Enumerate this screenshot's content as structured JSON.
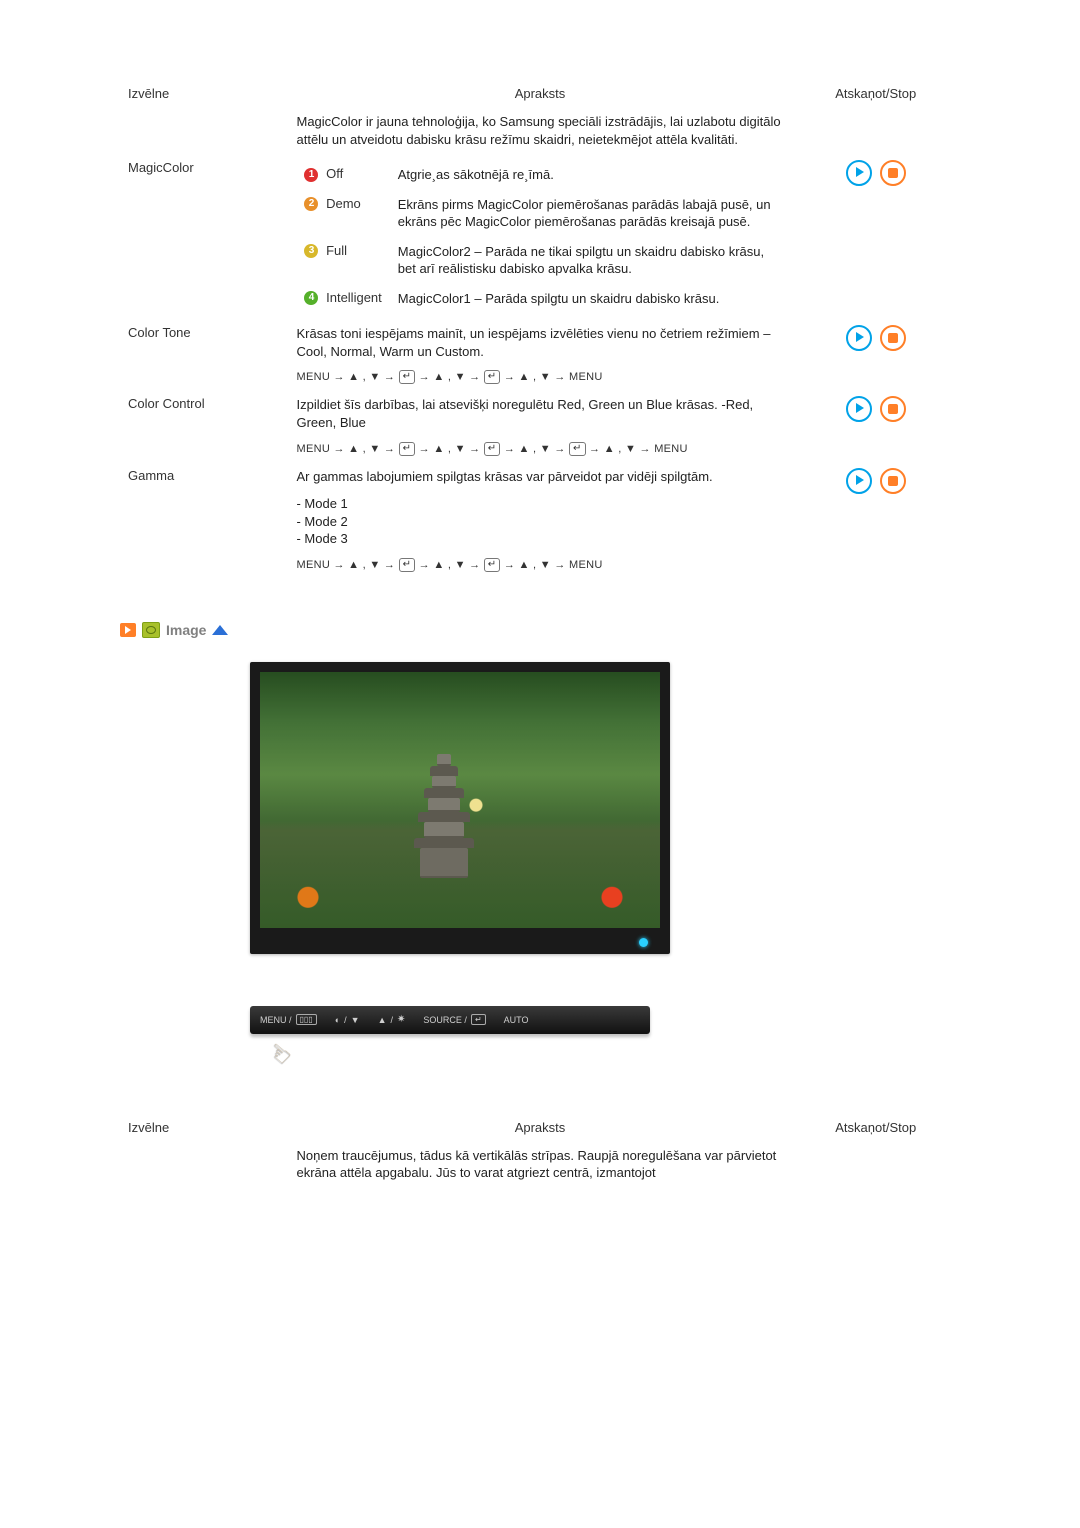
{
  "headers": {
    "menu": "Izvēlne",
    "description": "Apraksts",
    "playstop": "Atskaņot/Stop"
  },
  "magiccolor": {
    "name": "MagicColor",
    "intro": "MagicColor ir jauna tehnoloģija, ko Samsung speciāli izstrādājis, lai uzlabotu digitālo attēlu un atveidotu dabisku krāsu režīmu skaidri, neietekmējot attēla kvalitāti.",
    "opts": [
      {
        "n": "1",
        "label": "Off",
        "desc": "Atgrie¸as sākotnējā re¸īmā."
      },
      {
        "n": "2",
        "label": "Demo",
        "desc": "Ekrāns pirms MagicColor piemērošanas parādās labajā pusē, un ekrāns pēc MagicColor piemērošanas parādās kreisajā pusē."
      },
      {
        "n": "3",
        "label": "Full",
        "desc": "MagicColor2 – Parāda ne tikai spilgtu un skaidru dabisko krāsu, bet arī reālistisku dabisko apvalka krāsu."
      },
      {
        "n": "4",
        "label": "Intelligent",
        "desc": "MagicColor1 – Parāda spilgtu un skaidru dabisko krāsu."
      }
    ]
  },
  "colortone": {
    "name": "Color Tone",
    "desc": "Krāsas toni iespējams mainīt, un iespējams izvēlēties vienu no četriem režīmiem – Cool, Normal, Warm un Custom."
  },
  "colorcontrol": {
    "name": "Color Control",
    "desc": "Izpildiet šīs darbības, lai atsevišķi noregulētu Red, Green un Blue krāsas. -Red, Green, Blue"
  },
  "gamma": {
    "name": "Gamma",
    "desc": "Ar gammas labojumiem spilgtas krāsas var pārveidot par vidēji spilgtām.",
    "modes": "- Mode 1\n- Mode 2\n- Mode 3"
  },
  "nav": {
    "menu": "MENU",
    "arrow": "→",
    "updown": "▲ , ▼",
    "enter": "↵"
  },
  "section": {
    "image": "Image"
  },
  "strip": {
    "menu": "MENU /",
    "source": "SOURCE /",
    "auto": "AUTO"
  },
  "coarse": {
    "desc": "Noņem traucējumus, tādus kā vertikālās strīpas. Raupjā noregulēšana var pārvietot ekrāna attēla apgabalu. Jūs to varat atgriezt centrā, izmantojot"
  }
}
